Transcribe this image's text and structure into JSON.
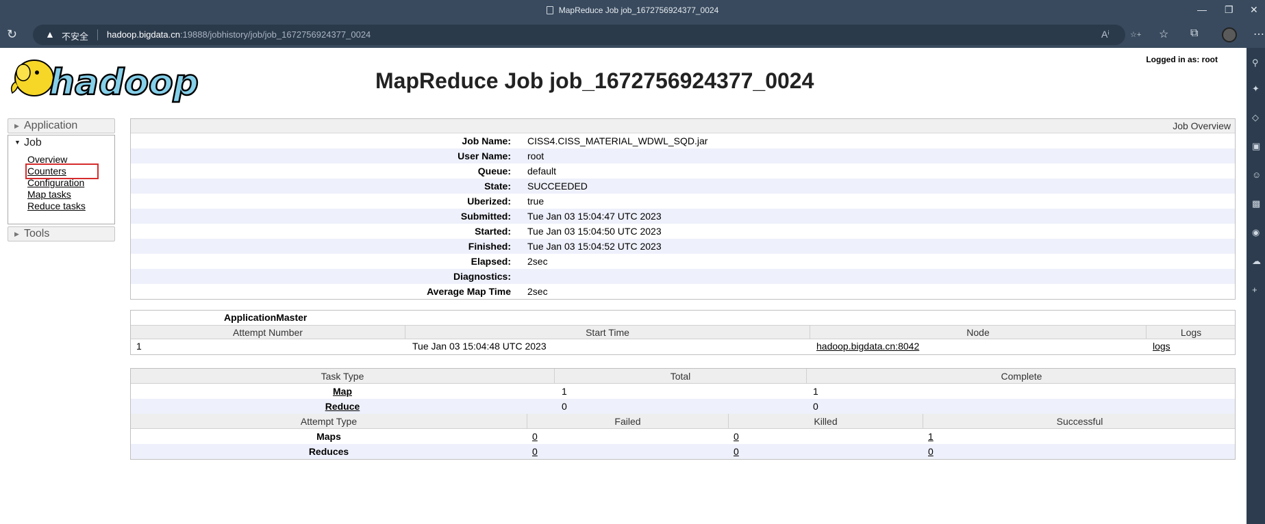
{
  "browser": {
    "tab_title": "MapReduce Job job_1672756924377_0024",
    "insecure_label": "不安全",
    "url_host": "hadoop.bigdata.cn",
    "url_path": ":19888/jobhistory/job/job_1672756924377_0024"
  },
  "header": {
    "logged_in": "Logged in as: root",
    "title": "MapReduce Job job_1672756924377_0024",
    "logo_text": "hadoop"
  },
  "nav": {
    "application": "Application",
    "job": "Job",
    "job_links": [
      "Overview",
      "Counters",
      "Configuration",
      "Map tasks",
      "Reduce tasks"
    ],
    "tools": "Tools"
  },
  "overview": {
    "header": "Job Overview",
    "rows": [
      {
        "key": "Job Name:",
        "value": "CISS4.CISS_MATERIAL_WDWL_SQD.jar"
      },
      {
        "key": "User Name:",
        "value": "root"
      },
      {
        "key": "Queue:",
        "value": "default"
      },
      {
        "key": "State:",
        "value": "SUCCEEDED"
      },
      {
        "key": "Uberized:",
        "value": "true"
      },
      {
        "key": "Submitted:",
        "value": "Tue Jan 03 15:04:47 UTC 2023"
      },
      {
        "key": "Started:",
        "value": "Tue Jan 03 15:04:50 UTC 2023"
      },
      {
        "key": "Finished:",
        "value": "Tue Jan 03 15:04:52 UTC 2023"
      },
      {
        "key": "Elapsed:",
        "value": "2sec"
      },
      {
        "key": "Diagnostics:",
        "value": ""
      },
      {
        "key": "Average Map Time",
        "value": "2sec"
      }
    ]
  },
  "app_master": {
    "caption": "ApplicationMaster",
    "columns": [
      "Attempt Number",
      "Start Time",
      "Node",
      "Logs"
    ],
    "row": {
      "attempt": "1",
      "start": "Tue Jan 03 15:04:48 UTC 2023",
      "node": "hadoop.bigdata.cn:8042",
      "logs": "logs"
    }
  },
  "tasks": {
    "columns": [
      "Task Type",
      "Total",
      "Complete"
    ],
    "rows": [
      {
        "type": "Map",
        "total": "1",
        "complete": "1"
      },
      {
        "type": "Reduce",
        "total": "0",
        "complete": "0"
      }
    ],
    "attempt_columns": [
      "Attempt Type",
      "Failed",
      "Killed",
      "Successful"
    ],
    "attempt_rows": [
      {
        "type": "Maps",
        "failed": "0",
        "killed": "0",
        "successful": "1"
      },
      {
        "type": "Reduces",
        "failed": "0",
        "killed": "0",
        "successful": "0"
      }
    ]
  }
}
